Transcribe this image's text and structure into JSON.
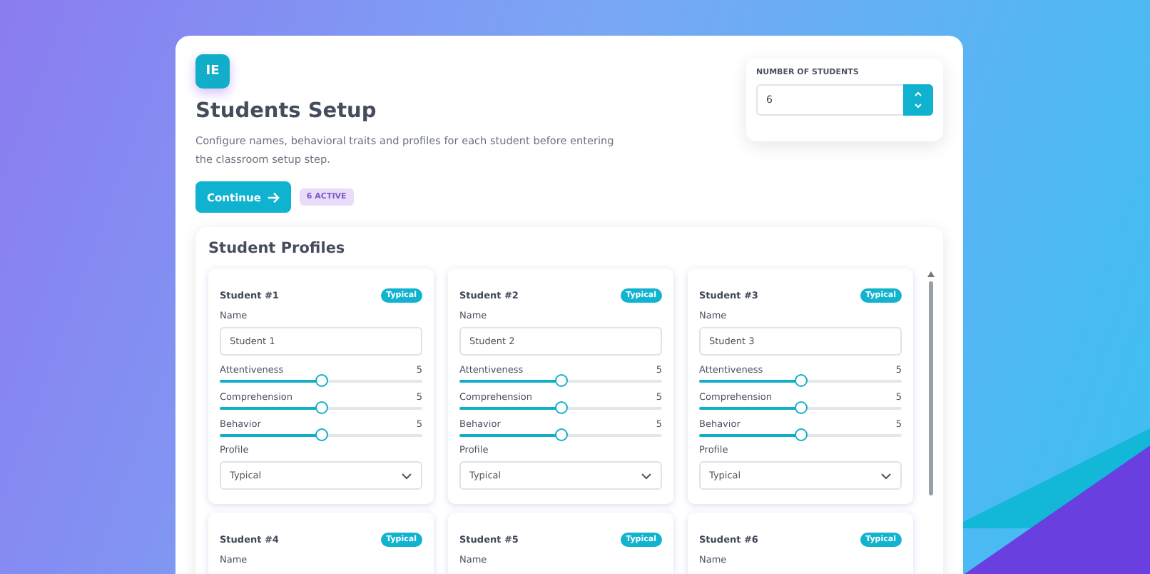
{
  "header": {
    "logo": "IE",
    "title": "Students Setup",
    "description": "Configure names, behavioral traits and profiles for each student before entering the classroom setup step.",
    "continue_button": "Continue",
    "active_badge": "6 ACTIVE"
  },
  "student_count": {
    "label": "NUMBER OF STUDENTS",
    "value": "6"
  },
  "profiles_panel": {
    "title": "Student Profiles",
    "students": [
      {
        "title": "Student #1",
        "badge": "Typical",
        "name_label": "Name",
        "name_value": "Student 1",
        "traits": [
          {
            "label": "Attentiveness",
            "reading": "5",
            "level": 0.5
          },
          {
            "label": "Comprehension",
            "reading": "5",
            "level": 0.5
          },
          {
            "label": "Behavior",
            "reading": "5",
            "level": 0.5
          }
        ],
        "profile_label": "Profile",
        "profile_value": "Typical"
      },
      {
        "title": "Student #2",
        "badge": "Typical",
        "name_label": "Name",
        "name_value": "Student 2",
        "traits": [
          {
            "label": "Attentiveness",
            "reading": "5",
            "level": 0.5
          },
          {
            "label": "Comprehension",
            "reading": "5",
            "level": 0.5
          },
          {
            "label": "Behavior",
            "reading": "5",
            "level": 0.5
          }
        ],
        "profile_label": "Profile",
        "profile_value": "Typical"
      },
      {
        "title": "Student #3",
        "badge": "Typical",
        "name_label": "Name",
        "name_value": "Student 3",
        "traits": [
          {
            "label": "Attentiveness",
            "reading": "5",
            "level": 0.5
          },
          {
            "label": "Comprehension",
            "reading": "5",
            "level": 0.5
          },
          {
            "label": "Behavior",
            "reading": "5",
            "level": 0.5
          }
        ],
        "profile_label": "Profile",
        "profile_value": "Typical"
      },
      {
        "title": "Student #4",
        "badge": "Typical",
        "name_label": "Name"
      },
      {
        "title": "Student #5",
        "badge": "Typical",
        "name_label": "Name"
      },
      {
        "title": "Student #6",
        "badge": "Typical",
        "name_label": "Name"
      }
    ]
  }
}
